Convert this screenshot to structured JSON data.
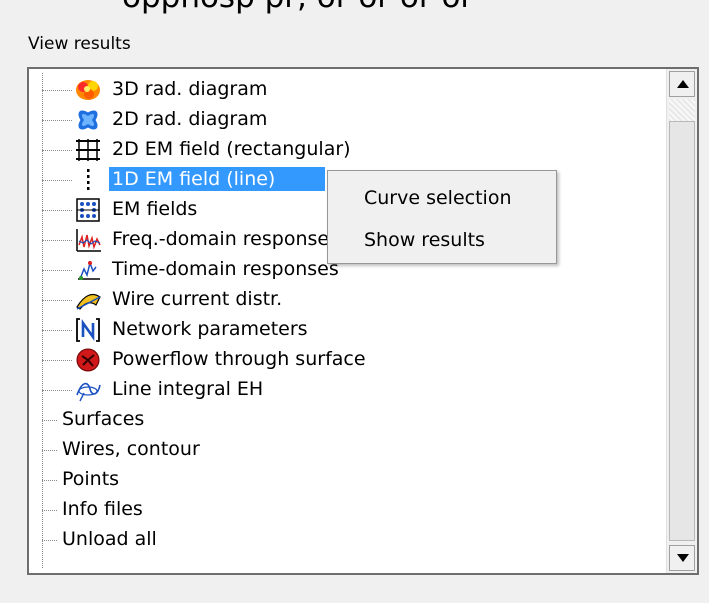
{
  "top_fragment": "opphosp pr, or or or or",
  "group_title": "View results",
  "tree_items": [
    {
      "label": "3D rad. diagram",
      "icon": "3d-rad-diagram-icon"
    },
    {
      "label": "2D rad. diagram",
      "icon": "2d-rad-diagram-icon"
    },
    {
      "label": "2D EM field (rectangular)",
      "icon": "grid-dots-icon"
    },
    {
      "label": "1D EM field (line)",
      "icon": "line-dots-icon",
      "selected": true
    },
    {
      "label": "EM fields",
      "icon": "em-fields-icon"
    },
    {
      "label": "Freq.-domain responses",
      "icon": "freq-domain-icon"
    },
    {
      "label": "Time-domain responses",
      "icon": "time-domain-icon"
    },
    {
      "label": "Wire current distr.",
      "icon": "wire-current-icon"
    },
    {
      "label": "Network parameters",
      "icon": "network-n-icon"
    },
    {
      "label": "Powerflow through surface",
      "icon": "powerflow-icon"
    },
    {
      "label": "Line integral EH",
      "icon": "line-integral-icon"
    },
    {
      "label": "Surfaces"
    },
    {
      "label": "Wires, contour"
    },
    {
      "label": "Points"
    },
    {
      "label": "Info files"
    },
    {
      "label": "Unload all"
    }
  ],
  "context_menu": {
    "items": [
      "Curve selection",
      "Show results"
    ]
  },
  "colors": {
    "selection": "#3399ff",
    "background": "#f0f0f0"
  }
}
